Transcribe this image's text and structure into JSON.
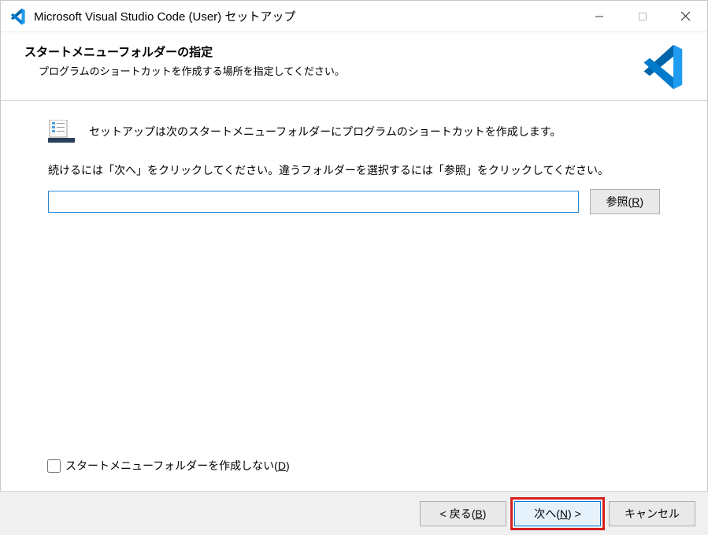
{
  "titlebar": {
    "title": "Microsoft Visual Studio Code (User) セットアップ"
  },
  "header": {
    "title": "スタートメニューフォルダーの指定",
    "subtitle": "プログラムのショートカットを作成する場所を指定してください。"
  },
  "body": {
    "info_text": "セットアップは次のスタートメニューフォルダーにプログラムのショートカットを作成します。",
    "continue_text": "続けるには「次へ」をクリックしてください。違うフォルダーを選択するには「参照」をクリックしてください。",
    "folder_input_value": "",
    "browse_label_prefix": "参照(",
    "browse_label_key": "R",
    "browse_label_suffix": ")"
  },
  "checkbox": {
    "label_prefix": "スタートメニューフォルダーを作成しない(",
    "label_key": "D",
    "label_suffix": ")"
  },
  "footer": {
    "back_prefix": "< 戻る(",
    "back_key": "B",
    "back_suffix": ")",
    "next_prefix": "次へ(",
    "next_key": "N",
    "next_suffix": ") >",
    "cancel": "キャンセル"
  },
  "colors": {
    "accent": "#0078d7",
    "highlight_border": "#d82020"
  }
}
